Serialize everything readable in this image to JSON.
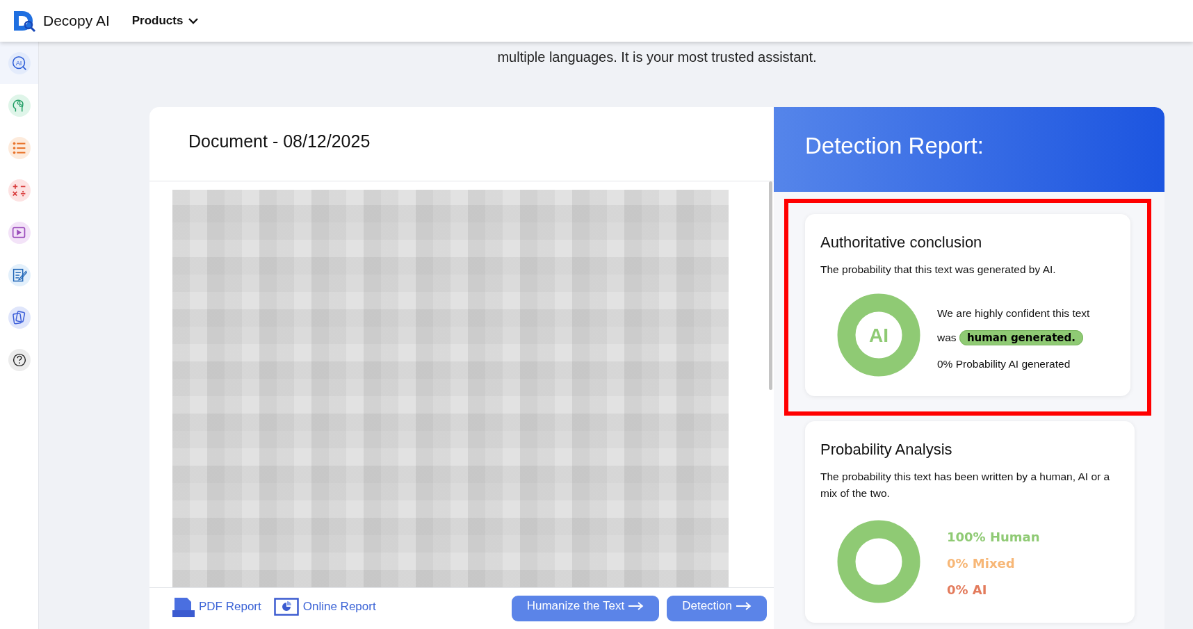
{
  "header": {
    "brand": "Decopy AI",
    "menu": "Products"
  },
  "sidebar": {
    "items": [
      {
        "kind": "ai-search",
        "selected": true,
        "color": "#e3ebfb",
        "icon_text": "AI"
      },
      {
        "kind": "brain",
        "selected": false,
        "color": "#dff5e9"
      },
      {
        "kind": "list",
        "selected": false,
        "color": "#fdebdc"
      },
      {
        "kind": "math",
        "selected": false,
        "color": "#fde3e3"
      },
      {
        "kind": "video",
        "selected": false,
        "color": "#f3e3f8"
      },
      {
        "kind": "notes",
        "selected": false,
        "color": "#e3f0fb"
      },
      {
        "kind": "cards",
        "selected": false,
        "color": "#e0e6fb"
      },
      {
        "kind": "help",
        "selected": false,
        "color": "#ececec"
      }
    ]
  },
  "intro": "multiple languages. It is your most trusted assistant.",
  "document": {
    "title": "Document - 08/12/2025",
    "actions": [
      {
        "kind": "pdf",
        "label": "PDF Report"
      },
      {
        "kind": "online",
        "label": "Online Report"
      }
    ],
    "buttons": [
      {
        "label": "Humanize the Text"
      },
      {
        "label": "Detection"
      }
    ]
  },
  "report": {
    "title": "Detection Report:",
    "conclusion": {
      "title": "Authoritative conclusion",
      "subtitle": "The probability that this text was generated by AI.",
      "gauge_label": "AI",
      "statement_start": "We are highly confident this text was",
      "verdict": "human generated.",
      "probability": "0% Probability AI generated",
      "highlighted": true
    },
    "analysis": {
      "title": "Probability Analysis",
      "subtitle": "The probability this text has been written by a human, AI or a mix of the two.",
      "legend": [
        {
          "label": "100% Human",
          "color": "#8fca74"
        },
        {
          "label": "0% Mixed",
          "color": "#f7b777"
        },
        {
          "label": "0% AI",
          "color": "#e37b5c"
        }
      ]
    }
  }
}
